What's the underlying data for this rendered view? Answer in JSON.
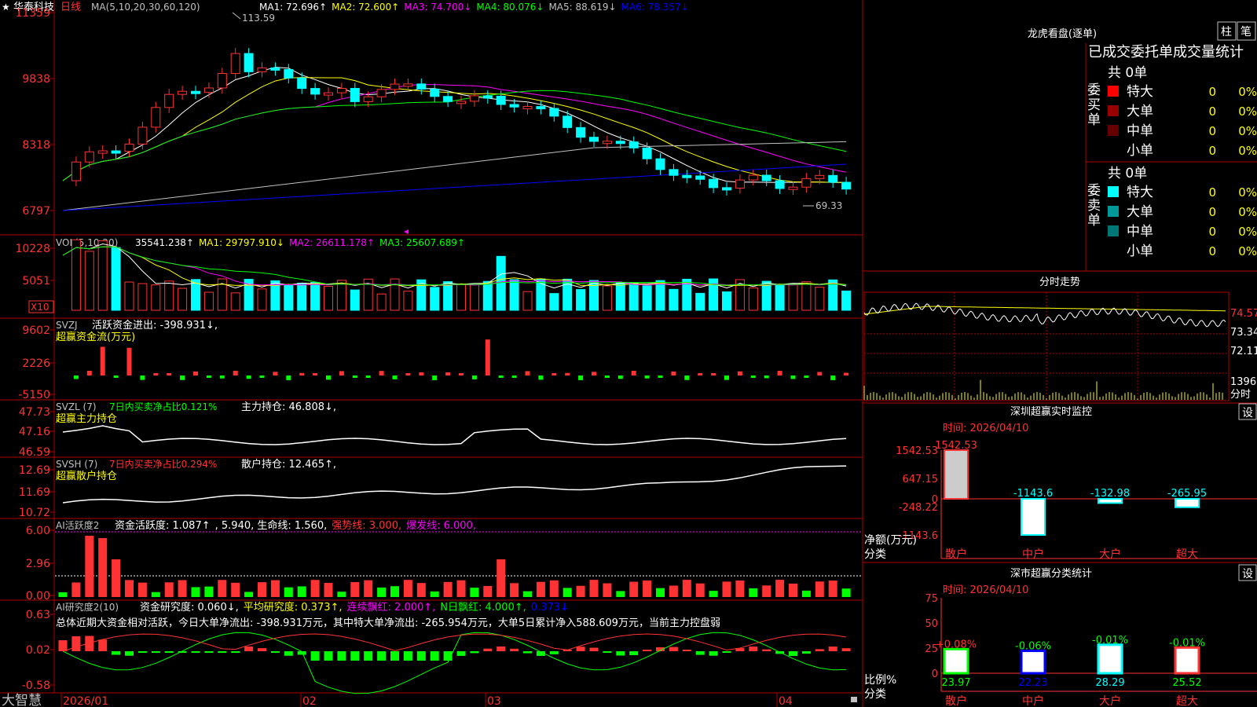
{
  "brand": "大智慧",
  "header": {
    "stock_name": "华泰科技",
    "period": "日线",
    "ma_params": "MA(5,10,20,30,60,120)",
    "items": [
      {
        "text": "MA1: 72.696↑",
        "color": "#ffffff"
      },
      {
        "text": "MA2: 72.600↑",
        "color": "#ffff00"
      },
      {
        "text": "MA3: 74.700↓",
        "color": "#ff00ff"
      },
      {
        "text": "MA4: 80.076↓",
        "color": "#00ff00"
      },
      {
        "text": "MA5: 88.619↓",
        "color": "#c0c0c0"
      },
      {
        "text": "MA6: 78.357↓",
        "color": "#0000ff"
      }
    ]
  },
  "price_panel": {
    "y_ticks": [
      "11359",
      "9838",
      "8318",
      "6797"
    ],
    "high_label": "113.59",
    "low_label": "69.33"
  },
  "vol_panel": {
    "title": "VOL(5,10,20)",
    "items": [
      {
        "text": "35541.238↑",
        "color": "#ffffff"
      },
      {
        "text": "MA1: 29797.910↓",
        "color": "#ffff00"
      },
      {
        "text": "MA2: 26611.178↑",
        "color": "#ff00ff"
      },
      {
        "text": "MA3: 25607.689↑",
        "color": "#00ff00"
      }
    ],
    "y_ticks": [
      "10228",
      "5051"
    ],
    "unit": "X10"
  },
  "svzj_panel": {
    "title": "SVZJ",
    "subtitle": "活跃资金进出: -398.931↓,",
    "line2": "超赢资金流(万元)",
    "y_ticks": [
      "9602",
      "2226",
      "-5150"
    ]
  },
  "svzl_panel": {
    "title": "SVZL (7)",
    "desc": "7日内买卖净占比0.121%",
    "value": "主力持仓: 46.808↓,",
    "line2": "超赢主力持仓",
    "y_ticks": [
      "47.73",
      "47.16",
      "46.59"
    ]
  },
  "svsh_panel": {
    "title": "SVSH (7)",
    "desc": "7日内买卖净占比0.294%",
    "value": "散户持仓: 12.465↑,",
    "line2": "超赢散户持仓",
    "y_ticks": [
      "12.69",
      "11.69",
      "10.72"
    ]
  },
  "ai1_panel": {
    "title": "AI活跃度2",
    "items": [
      {
        "text": "资金活跃度: 1.087↑",
        "color": "#ffffff"
      },
      {
        "text": ", 5.940, 生命线: 1.560,",
        "color": "#ffffff"
      },
      {
        "text": "强势线: 3.000,",
        "color": "#ff3333"
      },
      {
        "text": "爆发线: 6.000,",
        "color": "#ff00ff"
      }
    ],
    "y_ticks": [
      "6.00",
      "2.96",
      "0.00"
    ]
  },
  "ai2_panel": {
    "title": "AI研究度2(10)",
    "items": [
      {
        "text": "资金研究度: 0.060↓,",
        "color": "#ffffff"
      },
      {
        "text": "平均研究度: 0.373↑,",
        "color": "#ffff00"
      },
      {
        "text": "连续飘红: 2.000↑,",
        "color": "#ff00ff"
      },
      {
        "text": "N日飘红: 4.000↑,",
        "color": "#00ff00"
      },
      {
        "text": "0.373↓",
        "color": "#0000ff"
      }
    ],
    "summary": "总体近期大资金相对活跃，今日大单净流出: -398.931万元，其中特大单净流出: -265.954万元，大单5日累计净入588.609万元，当前主力控盘弱",
    "y_ticks": [
      "0.63",
      "0.02",
      "-0.58"
    ]
  },
  "x_axis": [
    "2026/01",
    "02",
    "03",
    "04"
  ],
  "dragon_tiger": {
    "title": "龙虎看盘(逐单)",
    "btn1": "柱",
    "btn2": "笔",
    "subtitle": "已成交委托单成交量统计",
    "buy_label": [
      "委",
      "买",
      "单"
    ],
    "sell_label": [
      "委",
      "卖",
      "单"
    ],
    "buy_total": "共 0单",
    "sell_total": "共 0单",
    "buy_rows": [
      {
        "name": "特大",
        "count": "0",
        "pct": "0%",
        "color": "#ff0000"
      },
      {
        "name": "大单",
        "count": "0",
        "pct": "0%",
        "color": "#990000"
      },
      {
        "name": "中单",
        "count": "0",
        "pct": "0%",
        "color": "#660000"
      },
      {
        "name": "小单",
        "count": "0",
        "pct": "0%",
        "color": ""
      }
    ],
    "sell_rows": [
      {
        "name": "特大",
        "count": "0",
        "pct": "0%",
        "color": "#00ffff"
      },
      {
        "name": "大单",
        "count": "0",
        "pct": "0%",
        "color": "#009999"
      },
      {
        "name": "中单",
        "count": "0",
        "pct": "0%",
        "color": "#007777"
      },
      {
        "name": "小单",
        "count": "0",
        "pct": "0%",
        "color": ""
      }
    ]
  },
  "intraday": {
    "title": "分时走势",
    "price_ticks": [
      "74.57",
      "73.34",
      "72.11"
    ],
    "vol_tick": "1396",
    "vol_label": "分时"
  },
  "realtime_monitor": {
    "title": "深圳超赢实时监控",
    "btn": "设",
    "time": "时间: 2026/04/10",
    "y_ticks": [
      "1542.53",
      "647.15",
      "0",
      "-248.22",
      "-1143.6"
    ],
    "ylabel1": "净额(万元)",
    "ylabel2": "分类",
    "chart_data": {
      "type": "bar",
      "categories": [
        "散户",
        "中户",
        "大户",
        "超大"
      ],
      "values": [
        1542.53,
        -1143.6,
        -132.98,
        -265.95
      ],
      "labels": [
        "1542.53",
        "-1143.6",
        "-132.98",
        "-265.95"
      ],
      "ylim": [
        -1143.6,
        1542.53
      ]
    }
  },
  "category_stats": {
    "title": "深市超赢分类统计",
    "btn": "设",
    "time": "时间: 2026/04/10",
    "y_ticks": [
      "75",
      "50",
      "25",
      "0"
    ],
    "ylabel1": "比例%",
    "ylabel2": "分类",
    "chart_data": {
      "type": "bar",
      "categories": [
        "散户",
        "中户",
        "大户",
        "超大"
      ],
      "values": [
        23.97,
        22.23,
        28.29,
        25.52
      ],
      "value_labels": [
        "23.97",
        "22.23",
        "28.29",
        "25.52"
      ],
      "change_labels": [
        "+0.08%",
        "-0.06%",
        "-0.01%",
        "-0.01%"
      ],
      "ylim": [
        0,
        75
      ]
    }
  },
  "colors": {
    "up": "#ff3333",
    "down": "#00ffff",
    "grid": "#b00000",
    "axis_label": "#ff3333"
  }
}
